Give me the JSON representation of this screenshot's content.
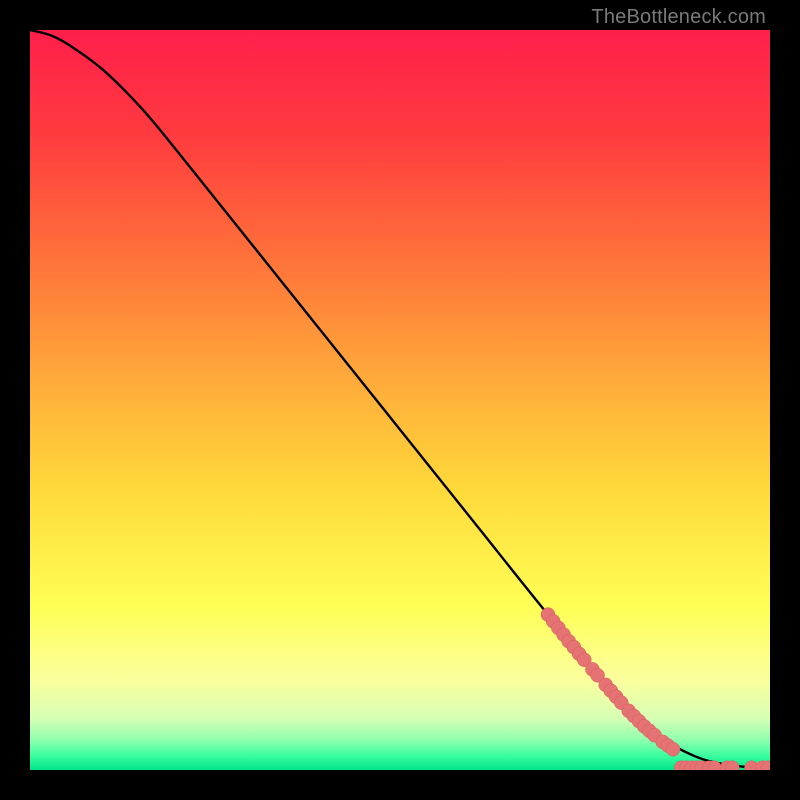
{
  "watermark": "TheBottleneck.com",
  "colors": {
    "black": "#000000",
    "curve": "#000000",
    "marker_fill": "#e57373",
    "marker_stroke": "#d95b5b",
    "gradient_stops": [
      {
        "pct": 0,
        "c": "#ff1f4b"
      },
      {
        "pct": 14,
        "c": "#ff3a3f"
      },
      {
        "pct": 30,
        "c": "#ff6f3a"
      },
      {
        "pct": 46,
        "c": "#ffa63a"
      },
      {
        "pct": 62,
        "c": "#ffd93a"
      },
      {
        "pct": 78,
        "c": "#ffff55"
      },
      {
        "pct": 88,
        "c": "#faff9e"
      },
      {
        "pct": 93,
        "c": "#d7ffb5"
      },
      {
        "pct": 96,
        "c": "#8dffad"
      },
      {
        "pct": 98,
        "c": "#3dffa0"
      },
      {
        "pct": 100,
        "c": "#00e58c"
      }
    ]
  },
  "chart_data": {
    "type": "line",
    "title": "",
    "xlabel": "",
    "ylabel": "",
    "xlim": [
      0,
      100
    ],
    "ylim": [
      0,
      100
    ],
    "series": [
      {
        "name": "curve",
        "x": [
          0,
          3,
          6,
          10,
          15,
          20,
          30,
          40,
          50,
          60,
          70,
          78,
          85,
          90,
          95,
          100
        ],
        "y": [
          100,
          99.2,
          97.5,
          94.5,
          89.5,
          83.5,
          71.0,
          58.5,
          46.0,
          33.5,
          21.0,
          11.5,
          4.8,
          1.8,
          0.6,
          0.3
        ]
      }
    ],
    "markers": [
      {
        "x": 70.0,
        "y": 21.0
      },
      {
        "x": 70.7,
        "y": 20.1
      },
      {
        "x": 71.4,
        "y": 19.2
      },
      {
        "x": 72.1,
        "y": 18.3
      },
      {
        "x": 72.8,
        "y": 17.4
      },
      {
        "x": 73.5,
        "y": 16.6
      },
      {
        "x": 74.2,
        "y": 15.7
      },
      {
        "x": 74.9,
        "y": 14.9
      },
      {
        "x": 76.0,
        "y": 13.6
      },
      {
        "x": 76.7,
        "y": 12.8
      },
      {
        "x": 77.8,
        "y": 11.5
      },
      {
        "x": 78.5,
        "y": 10.7
      },
      {
        "x": 79.2,
        "y": 9.9
      },
      {
        "x": 79.9,
        "y": 9.1
      },
      {
        "x": 80.9,
        "y": 8.0
      },
      {
        "x": 81.6,
        "y": 7.3
      },
      {
        "x": 82.3,
        "y": 6.6
      },
      {
        "x": 83.0,
        "y": 5.9
      },
      {
        "x": 83.7,
        "y": 5.3
      },
      {
        "x": 84.4,
        "y": 4.7
      },
      {
        "x": 85.5,
        "y": 3.8
      },
      {
        "x": 86.2,
        "y": 3.3
      },
      {
        "x": 86.9,
        "y": 2.8
      },
      {
        "x": 88.0,
        "y": 0.3
      },
      {
        "x": 88.7,
        "y": 0.3
      },
      {
        "x": 89.4,
        "y": 0.3
      },
      {
        "x": 90.1,
        "y": 0.3
      },
      {
        "x": 90.8,
        "y": 0.3
      },
      {
        "x": 91.8,
        "y": 0.3
      },
      {
        "x": 92.5,
        "y": 0.3
      },
      {
        "x": 94.2,
        "y": 0.3
      },
      {
        "x": 94.9,
        "y": 0.3
      },
      {
        "x": 97.5,
        "y": 0.3
      },
      {
        "x": 99.0,
        "y": 0.3
      },
      {
        "x": 99.7,
        "y": 0.3
      }
    ],
    "marker_radius_px": 7
  }
}
